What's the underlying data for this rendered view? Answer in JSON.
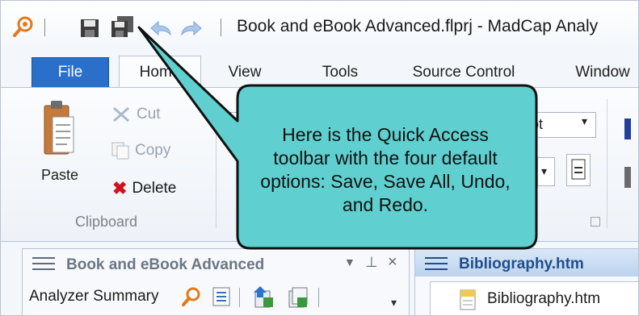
{
  "window": {
    "title": "Book and eBook Advanced.flprj - MadCap Analy"
  },
  "quick_access": {
    "icons": [
      "analyzer-logo-icon",
      "save-icon",
      "save-all-icon",
      "undo-icon",
      "redo-icon"
    ]
  },
  "ribbon": {
    "tabs": [
      "File",
      "Home",
      "View",
      "Tools",
      "Source Control",
      "Window"
    ],
    "clipboard": {
      "paste": "Paste",
      "cut": "Cut",
      "copy": "Copy",
      "delete": "Delete",
      "group_label": "Clipboard"
    },
    "font_size_partial": "pt"
  },
  "left_pane": {
    "title": "Book and eBook Advanced",
    "toolbar_label": "Analyzer Summary"
  },
  "right_pane": {
    "title": "Bibliography.htm",
    "doc_tab": "Bibliography.htm"
  },
  "callout": {
    "text": "Here is the Quick Access toolbar with the four default options: Save, Save All, Undo, and Redo.",
    "fill": "#5fd0cf",
    "stroke": "#111111"
  },
  "colors": {
    "file_tab": "#2a6fc9",
    "accent": "#1f4f8c"
  }
}
